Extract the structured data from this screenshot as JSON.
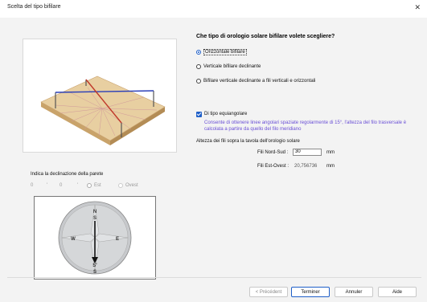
{
  "window": {
    "title": "Scelta del tipo bifilare",
    "close_glyph": "✕"
  },
  "question": "Che tipo di orologio solare bifilare volete scegliere?",
  "options": [
    {
      "label": "Orizzontale bifilare",
      "selected": true
    },
    {
      "label": "Verticale bifilare declinante",
      "selected": false
    },
    {
      "label": "Bifilare verticale declinante a fili verticali e orizzontali",
      "selected": false
    }
  ],
  "equiangular": {
    "label": "Di tipo equiangolare",
    "checked": true,
    "description": "Consente di ottenere linee angolari spaziate regolarmente di 15°, l'altezza del filo trasversale è calcolata a partire da quello del filo meridiano"
  },
  "heights": {
    "section_label": "Altezza dei fili sopra la tavola dell'orologio solare",
    "north_south_label": "Fili Nord-Sud :",
    "north_south_value": "30",
    "north_south_unit": "mm",
    "east_west_label": "Fili Est-Ovest :",
    "east_west_value": "20,756736",
    "east_west_unit": "mm"
  },
  "declination": {
    "label": "Indica la declinazione della parete",
    "degrees": "0",
    "minutes": "0",
    "east_label": "Est",
    "west_label": "Ovest"
  },
  "compass": {
    "n": "N",
    "s": "S",
    "w": "W",
    "e": "E",
    "s_prime": "S'"
  },
  "buttons": {
    "back": "< Précédent",
    "finish": "Terminer",
    "cancel": "Annuler",
    "help": "Aide"
  },
  "colors": {
    "accent": "#1f5fc8",
    "description_text": "#6a4fd6",
    "wire_blue": "#2b3fb8",
    "wire_red": "#c0392b",
    "board": "#e8cfa1"
  }
}
